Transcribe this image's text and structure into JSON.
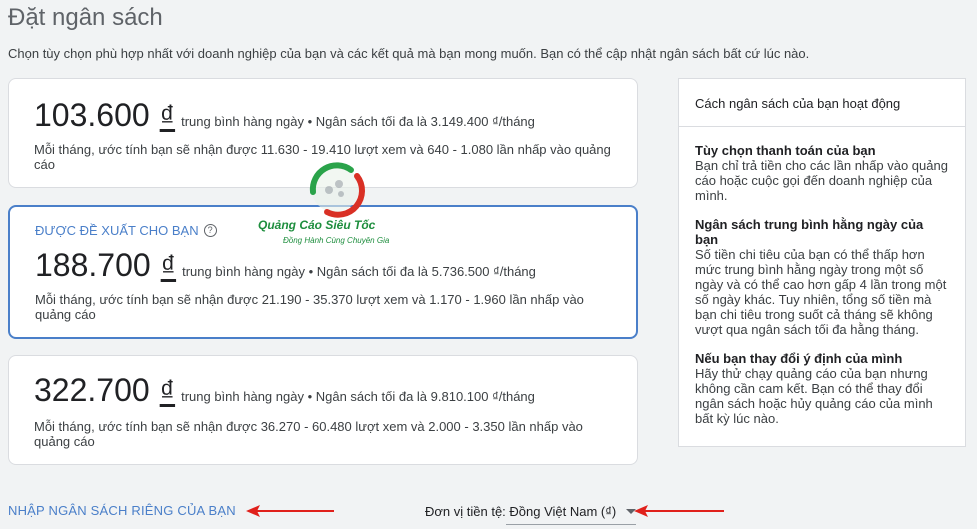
{
  "header": {
    "title": "Đặt ngân sách",
    "subtitle": "Chọn tùy chọn phù hợp nhất với doanh nghiệp của bạn và các kết quả mà bạn mong muốn. Bạn có thể cập nhật ngân sách bất cứ lúc nào."
  },
  "options": [
    {
      "amount": "103.600",
      "currency": "₫",
      "summary": "trung bình hàng ngày • Ngân sách tối đa là 3.149.400 ₫/tháng",
      "estimate": "Mỗi tháng, ước tính bạn sẽ nhận được 11.630 - 19.410 lượt xem và 640 - 1.080 lần nhấp vào quảng cáo"
    },
    {
      "recommended_label": "ĐƯỢC ĐỀ XUẤT CHO BẠN",
      "amount": "188.700",
      "currency": "₫",
      "summary": "trung bình hàng ngày • Ngân sách tối đa là 5.736.500 ₫/tháng",
      "estimate": "Mỗi tháng, ước tính bạn sẽ nhận được 21.190 - 35.370 lượt xem và 1.170 - 1.960 lần nhấp vào quảng cáo"
    },
    {
      "amount": "322.700",
      "currency": "₫",
      "summary": "trung bình hàng ngày • Ngân sách tối đa là 9.810.100 ₫/tháng",
      "estimate": "Mỗi tháng, ước tính bạn sẽ nhận được 36.270 - 60.480 lượt xem và 2.000 - 3.350 lần nhấp vào quảng cáo"
    }
  ],
  "info_panel": {
    "title": "Cách ngân sách của bạn hoạt động",
    "sections": [
      {
        "heading": "Tùy chọn thanh toán của bạn",
        "body": "Bạn chỉ trả tiền cho các lần nhấp vào quảng cáo hoặc cuộc gọi đến doanh nghiệp của mình."
      },
      {
        "heading": "Ngân sách trung bình hằng ngày của bạn",
        "body": "Số tiền chi tiêu của bạn có thể thấp hơn mức trung bình hằng ngày trong một số ngày và có thể cao hơn gấp 4 lần trong một số ngày khác. Tuy nhiên, tổng số tiền mà bạn chi tiêu trong suốt cả tháng sẽ không vượt qua ngân sách tối đa hằng tháng."
      },
      {
        "heading": "Nếu bạn thay đổi ý định của mình",
        "body": "Hãy thử chạy quảng cáo của bạn nhưng không cần cam kết. Bạn có thể thay đổi ngân sách hoặc hủy quảng cáo của mình bất kỳ lúc nào."
      }
    ]
  },
  "footer": {
    "own_budget_link": "NHẬP NGÂN SÁCH RIÊNG CỦA BẠN",
    "currency_label": "Đơn vị tiền tệ: Đồng Việt Nam (₫)"
  },
  "watermark": {
    "name": "Quảng Cáo Siêu Tốc",
    "tagline": "Đồng Hành Cùng Chuyên Gia"
  },
  "colors": {
    "accent": "#4a7fc9",
    "annotation_arrow": "#e0201b"
  }
}
